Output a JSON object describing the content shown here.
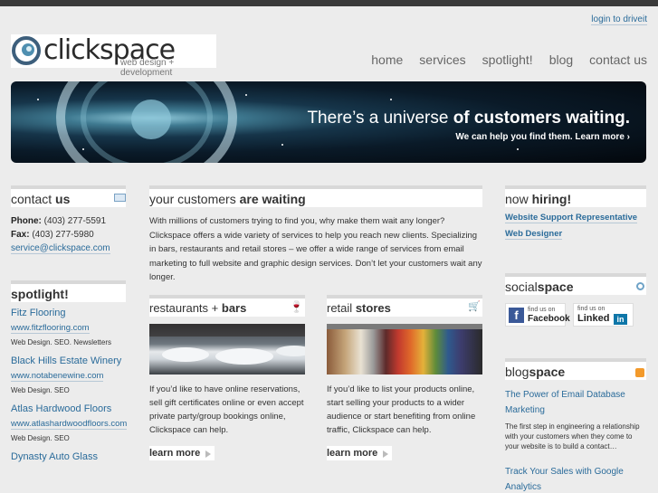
{
  "header": {
    "login_link": "login to driveit",
    "logo_name": "clickspace",
    "logo_tagline": "web design + development",
    "nav": [
      "home",
      "services",
      "spotlight!",
      "blog",
      "contact us"
    ]
  },
  "banner": {
    "headline_light": "There’s a universe",
    "headline_bold": "of customers waiting.",
    "subline": "We can help you find them. Learn more ›"
  },
  "contact": {
    "title_light": "contact",
    "title_bold": "us",
    "phone_label": "Phone:",
    "phone": "(403) 277-5591",
    "fax_label": "Fax:",
    "fax": "(403) 277-5980",
    "email": "service@clickspace.com"
  },
  "spotlight": {
    "title": "spotlight!",
    "items": [
      {
        "name": "Fitz Flooring",
        "url": "www.fitzflooring.com",
        "desc": "Web Design. SEO. Newsletters"
      },
      {
        "name": "Black Hills Estate Winery",
        "url": "www.notabenewine.com",
        "desc": "Web Design. SEO"
      },
      {
        "name": "Atlas Hardwood Floors",
        "url": "www.atlashardwoodfloors.com",
        "desc": "Web Design. SEO"
      },
      {
        "name": "Dynasty Auto Glass",
        "url": "",
        "desc": ""
      }
    ]
  },
  "main": {
    "title_light": "your customers",
    "title_bold": "are waiting",
    "intro": "With millions of customers trying to find you, why make them wait any longer? Clickspace offers a wide variety of services to help you reach new clients. Specializing in bars, restaurants and retail stores – we offer a wide range of services from email marketing to full website and graphic design services. Don’t let your customers wait any longer.",
    "cards": [
      {
        "title_light": "restaurants +",
        "title_bold": "bars",
        "text": "If you’d like to have online reservations, sell gift certificates online or even accept private party/group bookings online, Clickspace can help.",
        "more": "learn more"
      },
      {
        "title_light": "retail",
        "title_bold": "stores",
        "text": "If you’d like to list your products online, start selling your products to a wider audience or start benefiting from online traffic, Clickspace can help.",
        "more": "learn more"
      }
    ]
  },
  "hiring": {
    "title_light": "now",
    "title_bold": "hiring!",
    "jobs": [
      "Website Support Representative",
      "Web Designer"
    ]
  },
  "social": {
    "title_light": "social",
    "title_bold": "space",
    "facebook_find": "find us on",
    "facebook": "Facebook",
    "linkedin_find": "find us on",
    "linkedin": "Linked",
    "linkedin_in": "in"
  },
  "blog": {
    "title_light": "blog",
    "title_bold": "space",
    "posts": [
      {
        "title": "The Power of Email Database Marketing",
        "excerpt": "The first step in engineering a relationship with your customers when they come to your website is to build a contact…"
      },
      {
        "title": "Track Your Sales with Google Analytics",
        "excerpt": ""
      }
    ]
  },
  "colors": {
    "link": "#2a6b9a",
    "background": "#ececec",
    "topbar": "#3a3a3a"
  }
}
